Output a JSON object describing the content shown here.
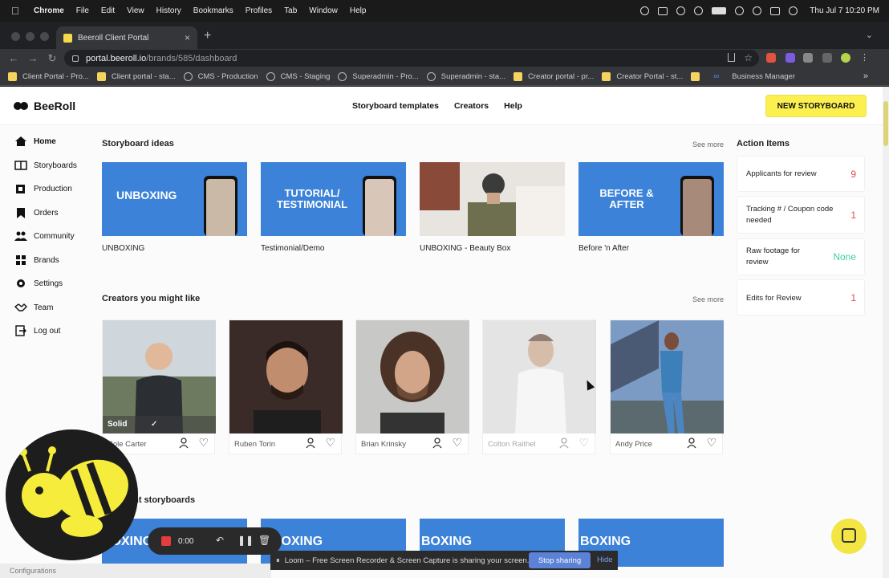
{
  "macos": {
    "app_name": "Chrome",
    "menus": [
      "File",
      "Edit",
      "View",
      "History",
      "Bookmarks",
      "Profiles",
      "Tab",
      "Window",
      "Help"
    ],
    "clock": "Thu Jul 7  10:20 PM"
  },
  "browser": {
    "tab_title": "Beeroll Client Portal",
    "url_host": "portal.beeroll.io",
    "url_path": "/brands/585/dashboard",
    "bookmarks": [
      {
        "label": "Client Portal - Pro...",
        "icon": "yellow"
      },
      {
        "label": "Client portal - sta...",
        "icon": "yellow"
      },
      {
        "label": "CMS - Production",
        "icon": "globe"
      },
      {
        "label": "CMS - Staging",
        "icon": "globe"
      },
      {
        "label": "Superadmin - Pro...",
        "icon": "globe"
      },
      {
        "label": "Superadmin - sta...",
        "icon": "globe"
      },
      {
        "label": "Creator portal - pr...",
        "icon": "yellow"
      },
      {
        "label": "Creator Portal - st...",
        "icon": "yellow"
      },
      {
        "label": "",
        "icon": "yellow"
      },
      {
        "label": "Business Manager",
        "icon": "meta"
      }
    ]
  },
  "header": {
    "logo_text": "BeeRoll",
    "nav": [
      "Storyboard templates",
      "Creators",
      "Help"
    ],
    "cta": "NEW STORYBOARD"
  },
  "sidebar": {
    "items": [
      {
        "label": "Home",
        "icon": "home-icon",
        "active": true
      },
      {
        "label": "Storyboards",
        "icon": "storyboards-icon"
      },
      {
        "label": "Production",
        "icon": "production-icon"
      },
      {
        "label": "Orders",
        "icon": "bookmark-icon"
      },
      {
        "label": "Community",
        "icon": "community-icon"
      },
      {
        "label": "Brands",
        "icon": "brands-icon"
      },
      {
        "label": "Settings",
        "icon": "gear-icon"
      },
      {
        "label": "Team",
        "icon": "handshake-icon"
      },
      {
        "label": "Log out",
        "icon": "logout-icon"
      }
    ]
  },
  "storyboard_ideas": {
    "title": "Storyboard ideas",
    "see_more": "See more",
    "items": [
      {
        "thumb_text": "UNBOXING",
        "label": "UNBOXING"
      },
      {
        "thumb_text": "TUTORIAL/ TESTIMONIAL",
        "label": "Testimonial/Demo"
      },
      {
        "thumb_text": "",
        "label": "UNBOXING - Beauty Box"
      },
      {
        "thumb_text": "BEFORE & AFTER",
        "label": "Before 'n After"
      }
    ]
  },
  "creators": {
    "title": "Creators you might like",
    "see_more": "See more",
    "items": [
      {
        "name": "Cole Carter",
        "badge": "Solid"
      },
      {
        "name": "Ruben Torin",
        "badge": ""
      },
      {
        "name": "Brian Krinsky",
        "badge": ""
      },
      {
        "name": "Colton Raithel",
        "badge": ""
      },
      {
        "name": "Andy Price",
        "badge": ""
      }
    ]
  },
  "recent": {
    "title": "ent storyboards",
    "thumb_text": "BOXING"
  },
  "action_items": {
    "title": "Action Items",
    "items": [
      {
        "label": "Applicants for review",
        "value": "9",
        "color": "#e14b4b"
      },
      {
        "label": "Tracking # / Coupon code needed",
        "value": "1",
        "color": "#e14b4b"
      },
      {
        "label": "Raw footage for review",
        "value": "None",
        "color": "#3fd0a0"
      },
      {
        "label": "Edits for Review",
        "value": "1",
        "color": "#e14b4b"
      }
    ]
  },
  "recorder": {
    "timer": "0:00"
  },
  "loom": {
    "message": "Loom – Free Screen Recorder & Screen Capture is sharing your screen.",
    "stop": "Stop sharing",
    "hide": "Hide"
  },
  "bottom_left": "Configurations"
}
